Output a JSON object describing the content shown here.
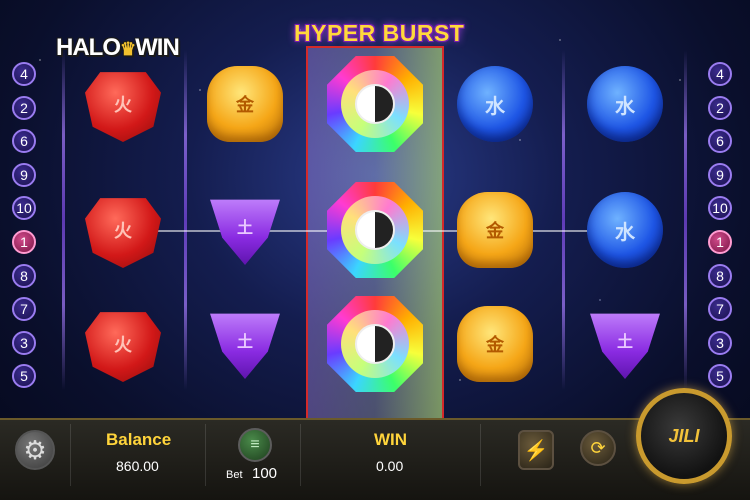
{
  "header": {
    "logo_text_left": "HALO",
    "logo_text_right": "WIN",
    "game_title": "HYPER BURST"
  },
  "paylines": {
    "left": [
      "4",
      "2",
      "6",
      "9",
      "10",
      "1",
      "8",
      "7",
      "3",
      "5"
    ],
    "right": [
      "4",
      "2",
      "6",
      "9",
      "10",
      "1",
      "8",
      "7",
      "3",
      "5"
    ],
    "active": "1"
  },
  "reels": [
    [
      "fire",
      "fire",
      "fire"
    ],
    [
      "gold",
      "earth",
      "earth"
    ],
    [
      "wild",
      "wild",
      "wild"
    ],
    [
      "water",
      "gold",
      "gold"
    ],
    [
      "water",
      "water",
      "earth"
    ]
  ],
  "symbol_glyphs": {
    "fire": "火",
    "gold": "金",
    "water": "水",
    "earth": "土"
  },
  "bottom_bar": {
    "balance_label": "Balance",
    "balance_value": "860.00",
    "bet_label": "Bet",
    "bet_value": "100",
    "win_label": "WIN",
    "win_value": "0.00",
    "spin_label": "JILI"
  },
  "icons": {
    "settings": "gear-icon",
    "bet": "coin-stack-icon",
    "turbo": "lightning-icon",
    "auto": "autoplay-icon",
    "spin": "spin-icon"
  }
}
